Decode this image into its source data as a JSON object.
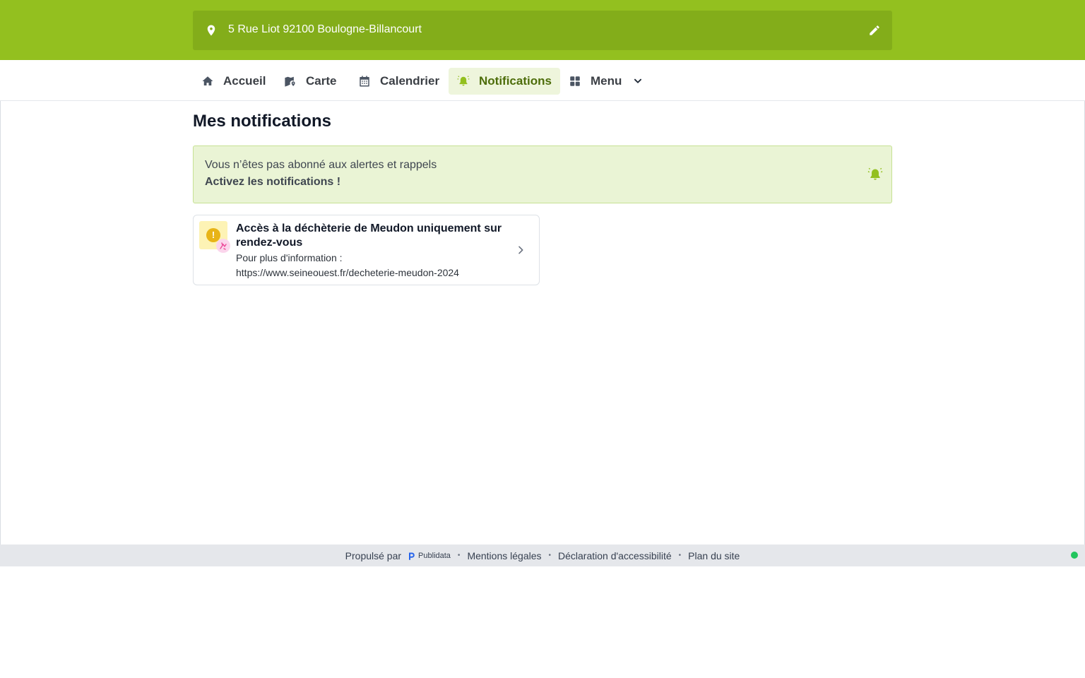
{
  "header": {
    "address": "5 Rue Liot 92100 Boulogne-Billancourt",
    "icons": {
      "location": "map-pin-icon",
      "edit": "pencil-icon"
    }
  },
  "nav": {
    "items": [
      {
        "label": "Accueil",
        "icon": "home-icon",
        "active": false
      },
      {
        "label": "Carte",
        "icon": "map-icon",
        "active": false
      },
      {
        "label": "Calendrier",
        "icon": "calendar-icon",
        "active": false
      },
      {
        "label": "Notifications",
        "icon": "bell-ringing-icon",
        "active": true
      },
      {
        "label": "Menu",
        "icon": "grid-icon",
        "active": false
      }
    ]
  },
  "main": {
    "title": "Mes notifications",
    "alert": {
      "line1": "Vous n’êtes pas abonné aux alertes et rappels",
      "line2": "Activez les notifications !"
    },
    "notifications": [
      {
        "title": "Accès à la déchèterie de Meudon uniquement sur rendez-vous",
        "body": "Pour plus d'information : https://www.seineouest.fr/decheterie-meudon-2024",
        "severity_icon": "warning-icon",
        "category_icon": "category-icon"
      }
    ]
  },
  "footer": {
    "powered_by": "Propulsé par",
    "brand": "Publidata",
    "links": [
      "Mentions légales",
      "Déclaration d'accessibilité",
      "Plan du site"
    ],
    "separator": "•"
  },
  "colors": {
    "brand_green": "#93c01f",
    "address_bg": "#83ad1a",
    "active_nav_bg": "#eef5dc",
    "active_nav_text": "#4d6d0a",
    "alert_bg": "#eaf4d5",
    "status_dot": "#22c55e"
  }
}
